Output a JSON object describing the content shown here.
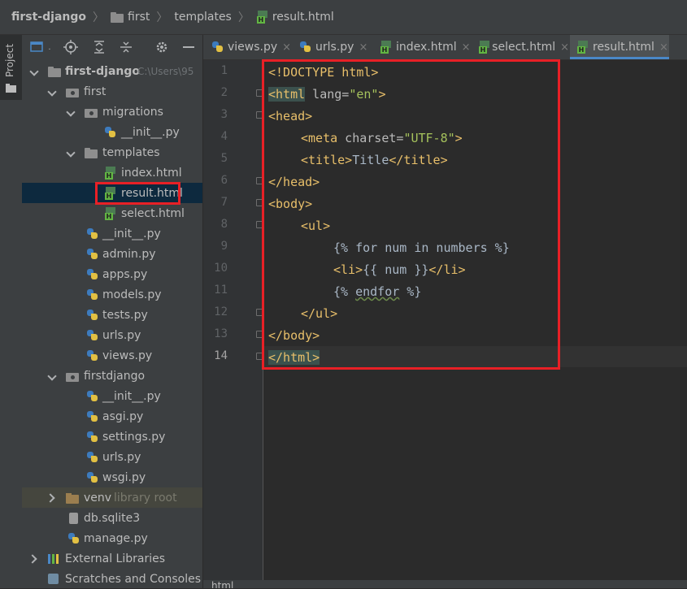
{
  "breadcrumb": [
    "first-django",
    "first",
    "templates",
    "result.html"
  ],
  "side_strip": {
    "label": "Project"
  },
  "tree": {
    "root_label": "first-django",
    "root_hint": "C:\\Users\\95",
    "first": "first",
    "migrations": "migrations",
    "migrations_init": "__init__.py",
    "templates": "templates",
    "index_html": "index.html",
    "result_html": "result.html",
    "select_html": "select.html",
    "first_files": [
      "__init__.py",
      "admin.py",
      "apps.py",
      "models.py",
      "tests.py",
      "urls.py",
      "views.py"
    ],
    "firstdjango": "firstdjango",
    "firstdjango_files": [
      "__init__.py",
      "asgi.py",
      "settings.py",
      "urls.py",
      "wsgi.py"
    ],
    "venv": "venv",
    "venv_hint": "library root",
    "db": "db.sqlite3",
    "manage": "manage.py",
    "external_libraries": "External Libraries",
    "scratches": "Scratches and Consoles"
  },
  "tabs": [
    {
      "label": "views.py",
      "icon": "python-file-icon"
    },
    {
      "label": "urls.py",
      "icon": "python-file-icon"
    },
    {
      "label": "index.html",
      "icon": "html-file-icon"
    },
    {
      "label": "select.html",
      "icon": "html-file-icon"
    },
    {
      "label": "result.html",
      "icon": "html-file-icon",
      "active": true
    }
  ],
  "tab_close": "×",
  "code": {
    "line_numbers": [
      "1",
      "2",
      "3",
      "4",
      "5",
      "6",
      "7",
      "8",
      "9",
      "10",
      "11",
      "12",
      "13",
      "14"
    ],
    "l1": "<!DOCTYPE html>",
    "l2_tag": "<html",
    "l2_attr": " lang=",
    "l2_val": "\"en\"",
    "l2_end": ">",
    "l3": "<head>",
    "l4_tag": "<meta",
    "l4_attr": " charset=",
    "l4_val": "\"UTF-8\"",
    "l4_end": ">",
    "l5_open": "<title>",
    "l5_text": "Title",
    "l5_close": "</title>",
    "l6": "</head>",
    "l7": "<body>",
    "l8": "<ul>",
    "l9": "{% for num in numbers %}",
    "l10_open": "<li>",
    "l10_text": "{{ num }}",
    "l10_close": "</li>",
    "l11_a": "{% ",
    "l11_kw": "endfor",
    "l11_b": " %}",
    "l12": "</ul>",
    "l13": "</body>",
    "l14": "</html>"
  },
  "status_text": "html",
  "colors": {
    "highlight_box": "#e82026",
    "accent": "#4a88c7"
  }
}
